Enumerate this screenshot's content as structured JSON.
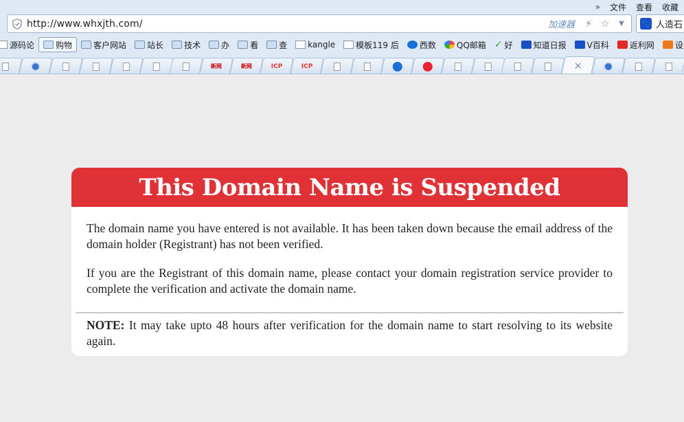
{
  "browser": {
    "menu": [
      "文件",
      "查看",
      "收藏"
    ],
    "more_icon": "»",
    "address": "http://www.whxjth.com/",
    "accelerator_label": "加速器",
    "search_text": "人造石",
    "favorites": [
      {
        "label": "源码论",
        "icon": "page"
      },
      {
        "label": "购物",
        "icon": "folder"
      },
      {
        "label": "客户网站",
        "icon": "folder"
      },
      {
        "label": "站长",
        "icon": "folder"
      },
      {
        "label": "技术",
        "icon": "folder"
      },
      {
        "label": "办",
        "icon": "folder"
      },
      {
        "label": "看",
        "icon": "folder"
      },
      {
        "label": "查",
        "icon": "folder"
      },
      {
        "label": "kangle",
        "icon": "page"
      },
      {
        "label": "模板119 后",
        "icon": "page"
      },
      {
        "label": "西数",
        "icon": "blue-circle"
      },
      {
        "label": "QQ邮箱",
        "icon": "color-circle"
      },
      {
        "label": "好",
        "icon": "green-check"
      },
      {
        "label": "知道日报",
        "icon": "baidu"
      },
      {
        "label": "V百科",
        "icon": "baidu"
      },
      {
        "label": "返利网",
        "icon": "red-square"
      },
      {
        "label": "设计",
        "icon": "orange-square"
      }
    ],
    "tabs": [
      "page",
      "qq",
      "page",
      "page",
      "page",
      "page",
      "page",
      "xin",
      "xin",
      "icp",
      "icp",
      "page",
      "page",
      "blue",
      "red",
      "page",
      "page",
      "page",
      "page",
      "active",
      "qq",
      "page",
      "page"
    ]
  },
  "notice": {
    "title": "This Domain Name is Suspended",
    "para1": "The domain name you have entered is not available. It has been taken down because the email address of the domain holder (Registrant) has not been verified.",
    "para2": "If you are the Registrant of this domain name, please contact your domain registration service provider to complete the verification and activate the domain name.",
    "note_label": "NOTE:",
    "note_text": " It may take upto 48 hours after verification for the domain name to start resolving to its website again.",
    "header_color": "#e03236"
  }
}
